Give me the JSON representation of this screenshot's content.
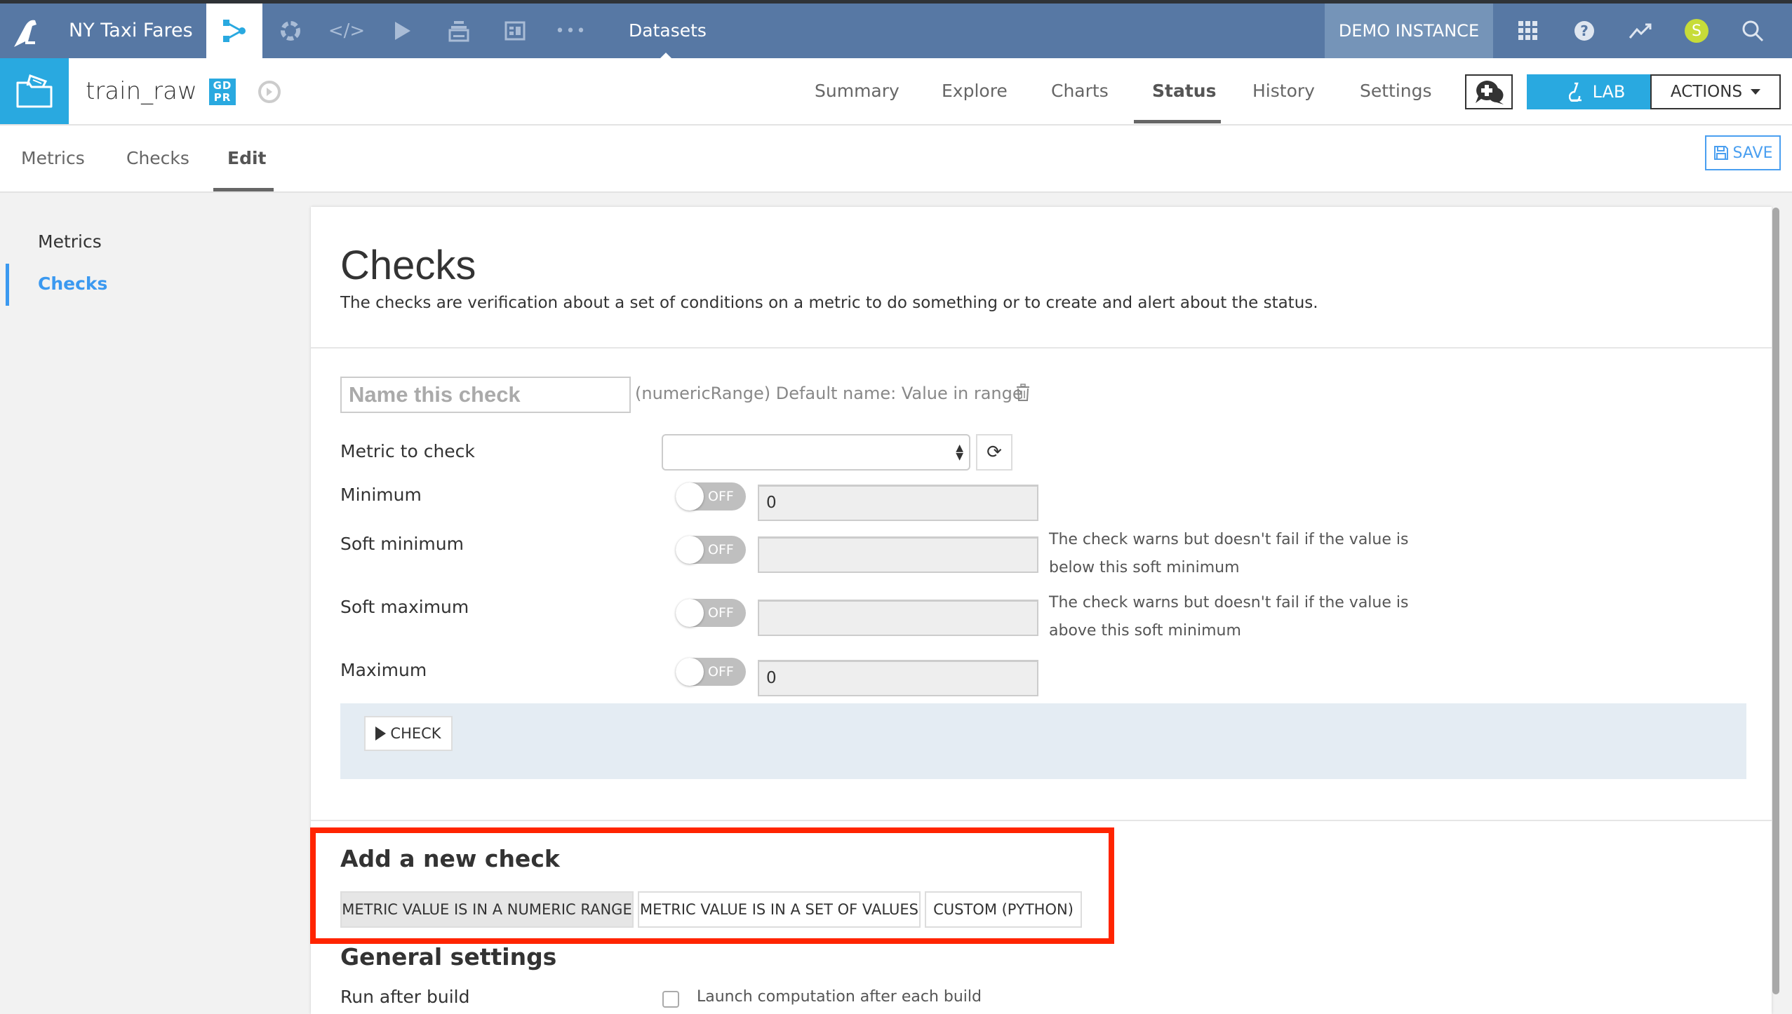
{
  "navbar": {
    "project_name": "NY Taxi Fares",
    "section_label": "Datasets",
    "instance_label": "DEMO INSTANCE",
    "avatar_initial": "S",
    "icons": [
      "flow-icon",
      "lab-icon",
      "code-icon",
      "run-icon",
      "deployer-icon",
      "dashboard-icon",
      "more-icon"
    ],
    "right_icons": [
      "apps-grid-icon",
      "help-icon",
      "activity-icon",
      "avatar",
      "search-icon"
    ]
  },
  "subheader": {
    "dataset_name": "train_raw",
    "gdpr_badge": "GD PR",
    "tabs": [
      {
        "label": "Summary",
        "active": false
      },
      {
        "label": "Explore",
        "active": false
      },
      {
        "label": "Charts",
        "active": false
      },
      {
        "label": "Status",
        "active": true
      },
      {
        "label": "History",
        "active": false
      },
      {
        "label": "Settings",
        "active": false
      }
    ],
    "lab_label": "LAB",
    "actions_label": "ACTIONS"
  },
  "subtabs": {
    "items": [
      {
        "label": "Metrics",
        "active": false
      },
      {
        "label": "Checks",
        "active": false
      },
      {
        "label": "Edit",
        "active": true
      }
    ],
    "save_label": "SAVE"
  },
  "leftnav": {
    "items": [
      {
        "label": "Metrics",
        "active": false
      },
      {
        "label": "Checks",
        "active": true
      }
    ]
  },
  "card": {
    "title": "Checks",
    "description": "The checks are verification about a set of conditions on a metric to do something or to create and alert about the status.",
    "check": {
      "name_placeholder": "Name this check",
      "name_value": "",
      "default_name": "(numericRange) Default name: Value in range",
      "metric_label": "Metric to check",
      "metric_value": "",
      "fields": [
        {
          "label": "Minimum",
          "toggle": "OFF",
          "value": "0",
          "help": ""
        },
        {
          "label": "Soft minimum",
          "toggle": "OFF",
          "value": "",
          "help": "The check warns but doesn't fail if the value is below this soft minimum"
        },
        {
          "label": "Soft maximum",
          "toggle": "OFF",
          "value": "",
          "help": "The check warns but doesn't fail if the value is above this soft minimum"
        },
        {
          "label": "Maximum",
          "toggle": "OFF",
          "value": "0",
          "help": ""
        }
      ],
      "check_button": "CHECK"
    },
    "add_new": {
      "heading": "Add a new check",
      "buttons": [
        {
          "label": "METRIC VALUE IS IN A NUMERIC RANGE",
          "selected": true
        },
        {
          "label": "METRIC VALUE IS IN A SET OF VALUES",
          "selected": false
        },
        {
          "label": "CUSTOM (PYTHON)",
          "selected": false
        }
      ]
    },
    "general": {
      "heading": "General settings",
      "run_after_build_label": "Run after build",
      "run_after_build_checkbox": "Launch computation after each build",
      "run_after_build_checked": false
    }
  },
  "colors": {
    "navbar_bg": "#5778a4",
    "accent_blue": "#29a9e0",
    "link_blue": "#3b99f0",
    "highlight_red": "#ff2400",
    "avatar": "#c7dc39"
  }
}
